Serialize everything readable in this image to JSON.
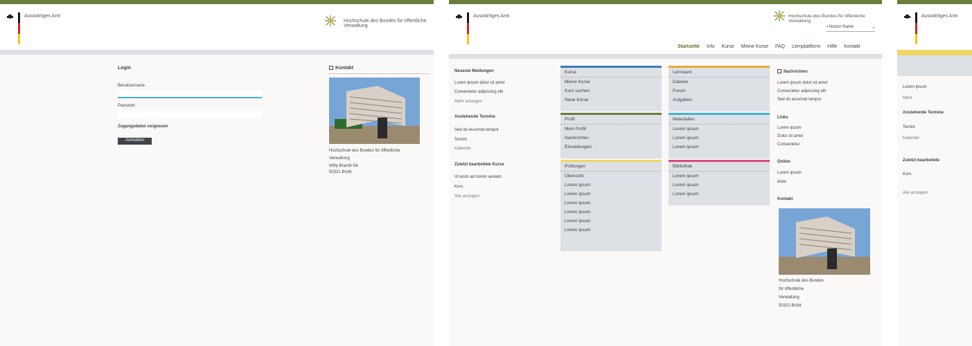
{
  "colors": {
    "accent": "#6b7d3b",
    "active_input": "#41b1d4",
    "tile_bg": "#dde0e4"
  },
  "panel1": {
    "ministry": "Auswärtiges Amt",
    "university": "Hochschule des Bundes für öffentliche Verwaltung",
    "login": {
      "title": "Login",
      "username_label": "Benutzername",
      "password_label": "Passwort",
      "forgot": "Zugangsdaten vergessen",
      "submit": "Anmelden"
    },
    "contact": {
      "title": "Kontakt",
      "lines": [
        "Hochschule des Bundes für öffentliche",
        "Verwaltung",
        "Willy-Brandt-Str.",
        "50321 Brühl"
      ]
    }
  },
  "panel2": {
    "ministry": "Auswärtiges Amt",
    "university": "Hochschule des Bundes für öffentliche Verwaltung",
    "user": "Nutzer Name",
    "nav": [
      "Startseite",
      "Info",
      "Kurse",
      "Meine Kurse",
      "FAQ",
      "Lernplattform",
      "Hilfe",
      "Kontakt"
    ],
    "left": {
      "news_title": "Neueste Meldungen",
      "news": [
        "Lorem ipsum dolor sit amet",
        "Consectetur adipiscing elit",
        "Mehr anzeigen"
      ],
      "events_title": "Anstehende Termine",
      "events": [
        "Sed do eiusmod tempor",
        "Termin",
        "Kalender"
      ],
      "recent_title": "Zuletzt bearbeitete Kurse",
      "recent": [
        "Ut enim ad minim veniam",
        "Kurs",
        "Alle anzeigen"
      ]
    },
    "tiles": [
      {
        "title": "Kurse",
        "color": "#3d7cb3",
        "rows": [
          "Meine Kurse",
          "Kurs suchen",
          "Neue Kurse"
        ]
      },
      {
        "title": "Lernraum",
        "color": "#e8a93c",
        "rows": [
          "Dateien",
          "Forum",
          "Aufgaben"
        ]
      },
      {
        "title": "Profil",
        "color": "#6b7d3b",
        "rows": [
          "Mein Profil",
          "Nachrichten",
          "Einstellungen"
        ]
      },
      {
        "title": "Materialien",
        "color": "#41b1d4",
        "rows": [
          "Lorem ipsum",
          "Lorem ipsum",
          "Lorem ipsum"
        ]
      },
      {
        "title": "Prüfungen",
        "color": "#f0d562",
        "rows": [
          "Übersicht",
          "Lorem ipsum",
          "Lorem ipsum",
          "Lorem ipsum",
          "Lorem ipsum",
          "Lorem ipsum",
          "Lorem ipsum"
        ]
      },
      {
        "title": "Bibliothek",
        "color": "#d94a7b",
        "rows": [
          "Lorem ipsum",
          "Lorem ipsum",
          "Lorem ipsum"
        ]
      }
    ],
    "right": {
      "messages_title": "Nachrichten",
      "messages": [
        "Lorem ipsum dolor sit amet",
        "Consectetur adipiscing elit",
        "Sed do eiusmod tempor"
      ],
      "links_title": "Links",
      "links": [
        "Lorem ipsum",
        "Dolor sit amet",
        "Consectetur"
      ],
      "online_title": "Online",
      "online": [
        "Lorem ipsum",
        "dolor"
      ],
      "contact_title": "Kontakt",
      "contact": [
        "Hochschule des Bundes",
        "für öffentliche",
        "Verwaltung",
        "50321 Brühl"
      ]
    }
  },
  "panel3": {
    "ministry": "Auswärtiges Amt",
    "lines": [
      "Lorem ipsum",
      "Mehr",
      "Anstehende Termine",
      "Termin",
      "Kalender",
      "Zuletzt bearbeitete",
      "Kurs",
      "Alle anzeigen"
    ]
  }
}
